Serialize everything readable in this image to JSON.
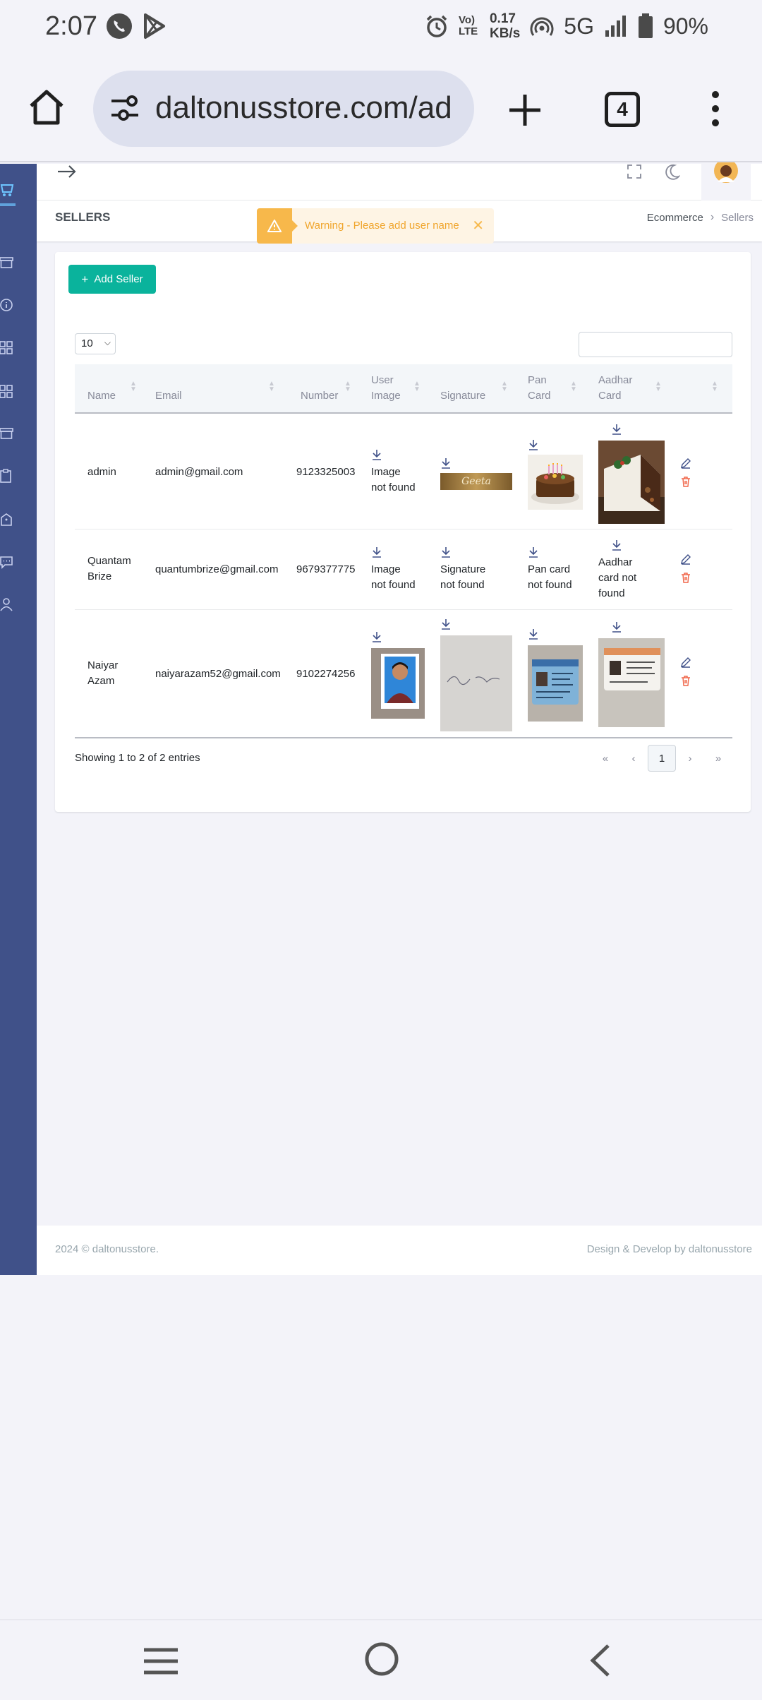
{
  "status_bar": {
    "time": "2:07",
    "net_speed_value": "0.17",
    "net_speed_unit": "KB/s",
    "network": "5G",
    "volte": "Vo) LTE",
    "battery": "90%"
  },
  "browser": {
    "url": "daltonusstore.com/ad",
    "tab_count": "4"
  },
  "page": {
    "title": "SELLERS",
    "breadcrumb": [
      "Ecommerce",
      "Sellers"
    ]
  },
  "toast": {
    "message": "Warning - Please add user name"
  },
  "actions": {
    "add_seller": "Add Seller"
  },
  "table": {
    "page_length": "10",
    "headers": {
      "name": "Name",
      "email": "Email",
      "number": "Number",
      "user_image_1": "User",
      "user_image_2": "Image",
      "signature": "Signature",
      "pan_1": "Pan",
      "pan_2": "Card",
      "aadhar_1": "Aadhar",
      "aadhar_2": "Card"
    },
    "rows": [
      {
        "name": "admin",
        "email": "admin@gmail.com",
        "number": "9123325003",
        "user_image_alt_1": "Image",
        "user_image_alt_2": "not found",
        "signature_text": "Geeta"
      },
      {
        "name_1": "Quantam",
        "name_2": "Brize",
        "email": "quantumbrize@gmail.com",
        "number": "9679377775",
        "user_image_alt_1": "Image",
        "user_image_alt_2": "not found",
        "signature_alt_1": "Signature",
        "signature_alt_2": "not found",
        "pan_alt_1": "Pan card",
        "pan_alt_2": "not found",
        "aadhar_alt_1": "Aadhar",
        "aadhar_alt_2": "card not",
        "aadhar_alt_3": "found"
      },
      {
        "name_1": "Naiyar",
        "name_2": "Azam",
        "email": "naiyarazam52@gmail.com",
        "number": "9102274256"
      }
    ],
    "info": "Showing 1 to 2 of 2 entries",
    "pagination": {
      "first": "«",
      "prev": "‹",
      "current": "1",
      "next": "›",
      "last": "»"
    }
  },
  "footer": {
    "copyright": "2024 © daltonusstore.",
    "credit": "Design & Develop by daltonusstore"
  },
  "colors": {
    "sidebar": "#405189",
    "primary_button": "#0ab39c",
    "warning": "#f7b84b",
    "danger": "#f06548"
  }
}
